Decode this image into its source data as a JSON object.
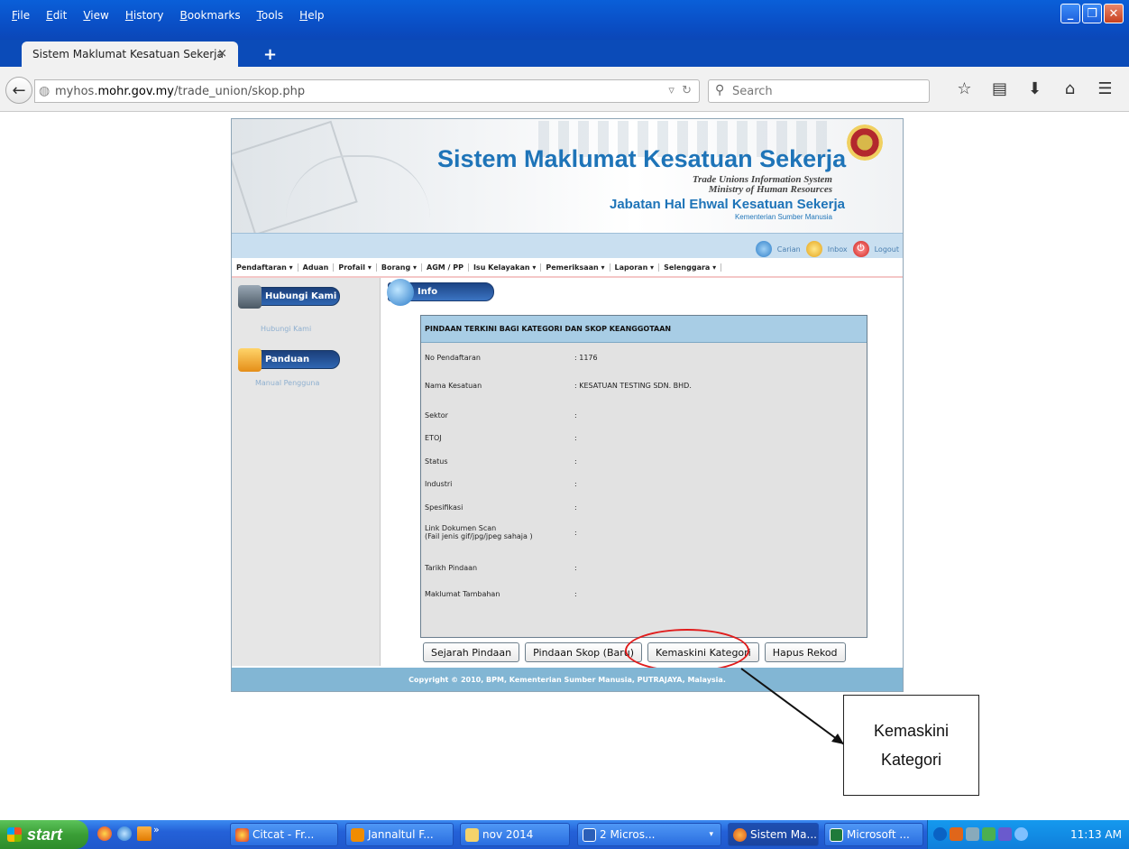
{
  "browser": {
    "menu": [
      "File",
      "Edit",
      "View",
      "History",
      "Bookmarks",
      "Tools",
      "Help"
    ],
    "tab_title": "Sistem Maklumat Kesatuan Sekerja",
    "tab_close": "×",
    "new_tab": "+",
    "url_prefix": "myhos.",
    "url_host": "mohr.gov.my",
    "url_path": "/trade_union/skop.php",
    "search_placeholder": "Search",
    "toolbar_icons": [
      "bookmark-star-icon",
      "reading-list-icon",
      "download-icon",
      "home-icon",
      "menu-icon"
    ]
  },
  "site": {
    "title": "Sistem Maklumat Kesatuan Sekerja",
    "subtitle_en": "Trade Unions Information System",
    "subtitle_ministry": "Ministry of Human Resources",
    "department": "Jabatan Hal Ehwal Kesatuan Sekerja",
    "department_sub": "Kementerian Sumber Manusia",
    "toplinks": {
      "search": "Carian",
      "inbox": "Inbox",
      "logout": "Logout"
    },
    "nav": [
      "Pendaftaran ▾",
      "Aduan",
      "Profail ▾",
      "Borang ▾",
      "AGM / PP",
      "Isu Kelayakan ▾",
      "Pemeriksaan ▾",
      "Laporan ▾",
      "Selenggara ▾"
    ],
    "sidebar": {
      "contact_header": "Hubungi Kami",
      "contact_link": "Hubungi Kami",
      "guide_header": "Panduan",
      "guide_link": "Manual Pengguna"
    },
    "info_label": "Info",
    "form": {
      "heading": "PINDAAN TERKINI BAGI KATEGORI DAN SKOP KEANGGOTAAN",
      "rows": [
        {
          "label": "No Pendaftaran",
          "value": ": 1176"
        },
        {
          "label": "Nama Kesatuan",
          "value": ": KESATUAN TESTING SDN. BHD."
        },
        {
          "label": "Sektor",
          "value": ":"
        },
        {
          "label": "ETOJ",
          "value": ":"
        },
        {
          "label": "Status",
          "value": ":"
        },
        {
          "label": "Industri",
          "value": ":"
        },
        {
          "label": "Spesifikasi",
          "value": ":"
        },
        {
          "label": "Link Dokumen Scan\n(Fail jenis gif/jpg/jpeg sahaja )",
          "value": ":"
        },
        {
          "label": "Tarikh Pindaan",
          "value": ":"
        },
        {
          "label": "Maklumat Tambahan",
          "value": ":"
        }
      ]
    },
    "buttons": {
      "history": "Sejarah Pindaan",
      "amend_new": "Pindaan Skop (Baru)",
      "update_category": "Kemaskini Kategori",
      "delete": "Hapus Rekod"
    },
    "footer": "Copyright © 2010, BPM, Kementerian Sumber Manusia, PUTRAJAYA, Malaysia."
  },
  "callout": {
    "line1": "Kemaskini",
    "line2": "Kategori"
  },
  "taskbar": {
    "start": "start",
    "more": "»",
    "items": [
      "Citcat - Fr...",
      "Jannaltul F...",
      "nov 2014",
      "2 Micros...",
      "Sistem Ma...",
      "Microsoft ..."
    ],
    "time": "11:13 AM"
  },
  "colors": {
    "accent": "#1e74b8",
    "highlight": "#e01c1c",
    "footer": "#82b6d4",
    "form_header": "#a8cde5"
  }
}
